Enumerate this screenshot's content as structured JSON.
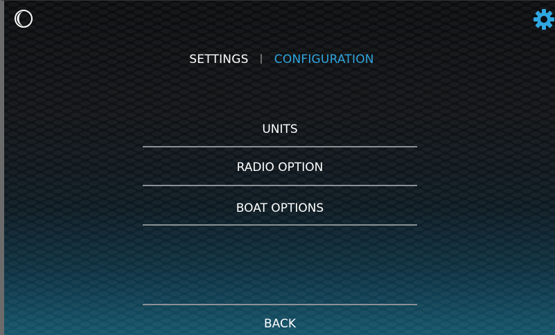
{
  "header": {
    "settings_label": "SETTINGS",
    "configuration_label": "CONFIGURATION"
  },
  "menu": {
    "items": [
      {
        "label": "UNITS"
      },
      {
        "label": "RADIO OPTION"
      },
      {
        "label": "BOAT OPTIONS"
      }
    ],
    "back_label": "BACK"
  },
  "icons": {
    "night_mode": "moon-icon",
    "settings": "gear-icon"
  },
  "colors": {
    "accent": "#2fa6e0",
    "text": "#ffffff",
    "divider": "#8c9196"
  }
}
